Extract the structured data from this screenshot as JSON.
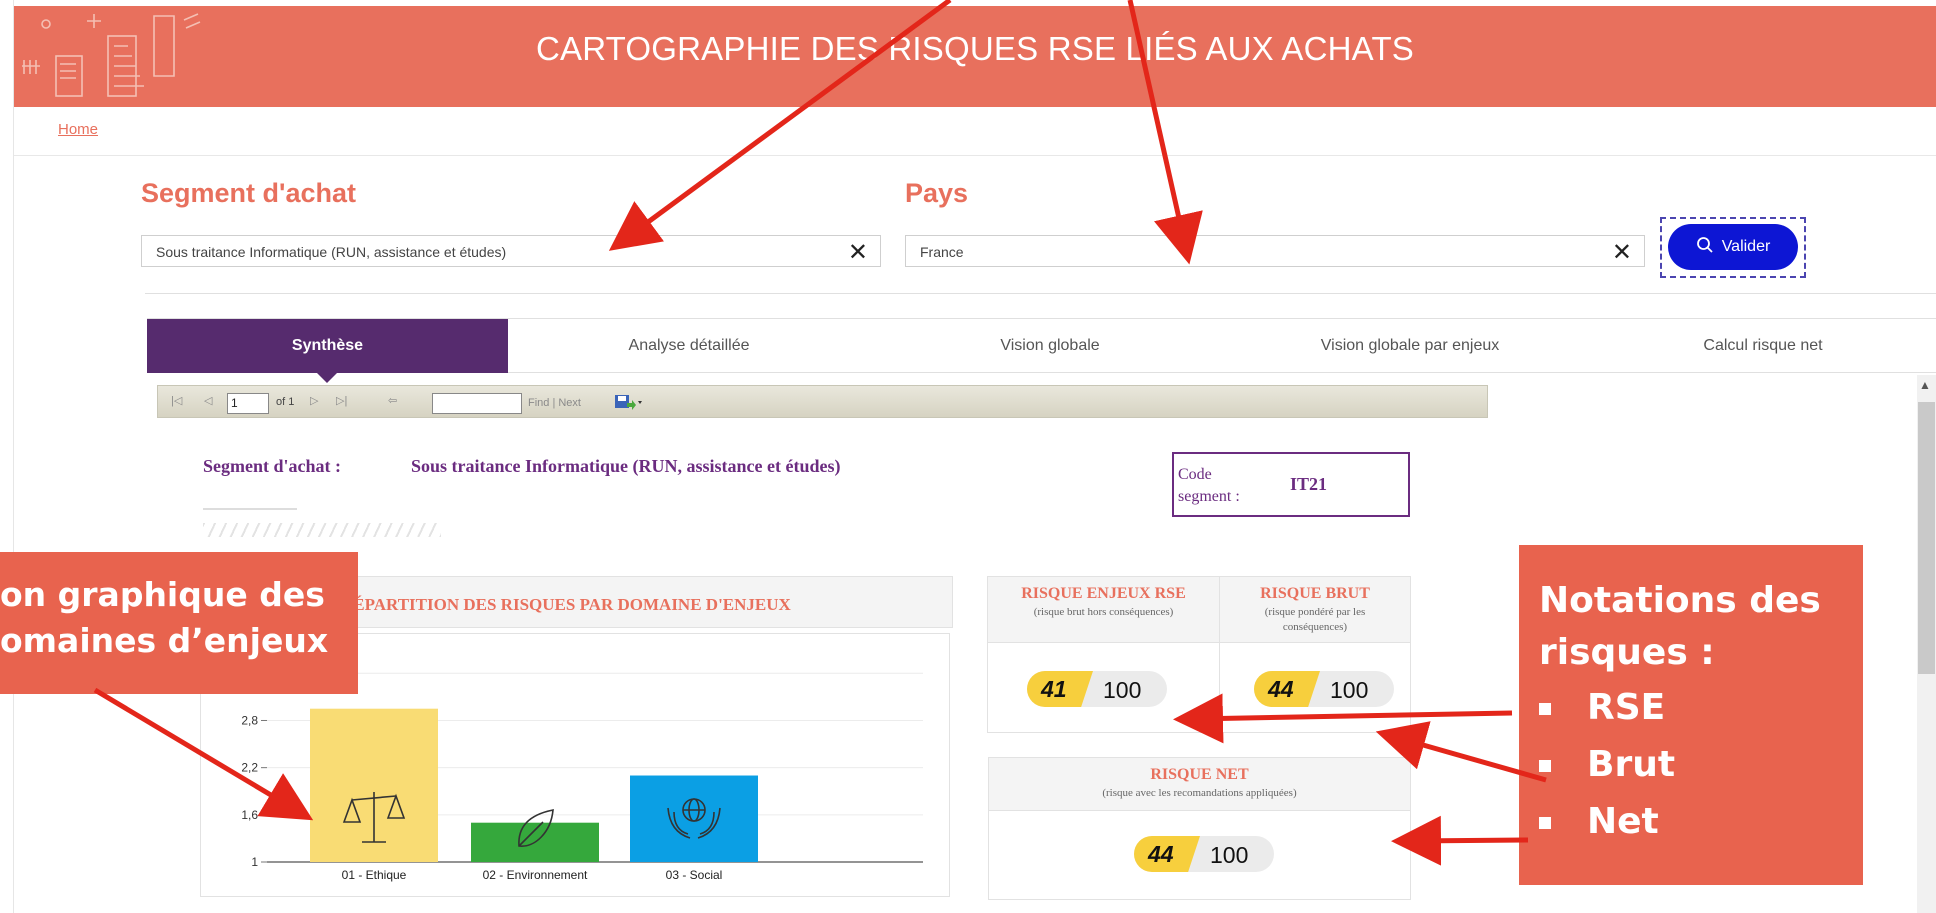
{
  "header": {
    "title": "CARTOGRAPHIE DES RISQUES RSE LIÉS AUX ACHATS"
  },
  "breadcrumb": {
    "home": "Home"
  },
  "filters": {
    "segment_label": "Segment d'achat",
    "segment_value": "Sous traitance Informatique (RUN, assistance et études)",
    "pays_label": "Pays",
    "pays_value": "France",
    "clear_symbol": "✕",
    "valider_label": "Valider"
  },
  "tabs": [
    {
      "label": "Synthèse",
      "active": true
    },
    {
      "label": "Analyse détaillée",
      "active": false
    },
    {
      "label": "Vision globale",
      "active": false
    },
    {
      "label": "Vision globale par enjeux",
      "active": false
    },
    {
      "label": "Calcul risque net",
      "active": false
    }
  ],
  "report_toolbar": {
    "page": "1",
    "of_label": "of 1",
    "find_label": "Find | Next"
  },
  "report": {
    "segment_label": "Segment d'achat :",
    "segment_value": "Sous traitance Informatique (RUN, assistance et études)",
    "code_label": "Code segment :",
    "code_value": "IT21",
    "chart_title": "RÉPARTITION DES RISQUES PAR DOMAINE D'ENJEUX"
  },
  "chart_data": {
    "type": "bar",
    "title": "RÉPARTITION DES RISQUES PAR DOMAINE D'ENJEUX",
    "categories": [
      "01 - Ethique",
      "02 - Environnement",
      "03 - Social"
    ],
    "values": [
      2.95,
      1.5,
      2.1
    ],
    "colors": [
      "#f9dc74",
      "#35a83c",
      "#0b9fe4"
    ],
    "icons": [
      "scales-icon",
      "leaf-icon",
      "globe-hands-icon"
    ],
    "yticks": [
      "1",
      "1,6",
      "2,2",
      "2,8",
      "3,4"
    ],
    "ylim": [
      1,
      3.9
    ]
  },
  "scores": {
    "rse": {
      "title": "RISQUE ENJEUX RSE",
      "subtitle": "(risque brut hors conséquences)",
      "value": "41",
      "max": "100"
    },
    "brut": {
      "title": "RISQUE BRUT",
      "subtitle": "(risque pondéré par les conséquences)",
      "value": "44",
      "max": "100"
    },
    "net": {
      "title": "RISQUE NET",
      "subtitle": "(risque avec les recomandations appliquées)",
      "value": "44",
      "max": "100"
    }
  },
  "annotations": {
    "left": [
      "on graphique des",
      "omaines d’enjeux"
    ],
    "right_title": [
      "Notations des",
      "risques :"
    ],
    "right_items": [
      "RSE",
      "Brut",
      "Net"
    ]
  },
  "colors": {
    "brand": "#e8705d",
    "tab_active": "#562b6e",
    "button": "#0d16d4",
    "arrow": "#e3261a"
  }
}
